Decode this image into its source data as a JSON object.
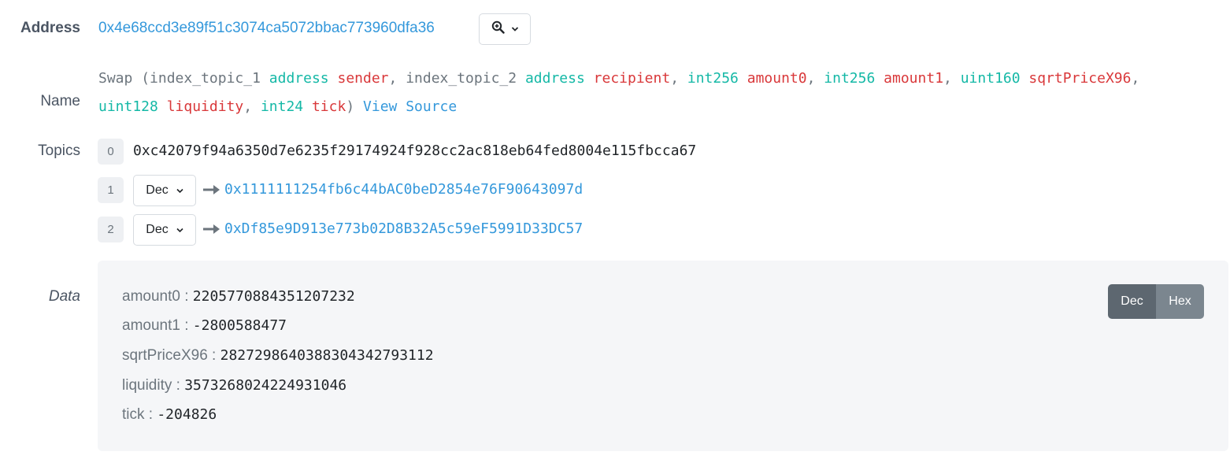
{
  "address": {
    "label": "Address",
    "value": "0x4e68ccd3e89f51c3074ca5072bbac773960dfa36",
    "zoom_icon": "zoom-in-icon",
    "dropdown_icon": "chevron-down-icon"
  },
  "name": {
    "label": "Name",
    "function_name": "Swap",
    "params": [
      {
        "prefix": "index_topic_1",
        "type": "address",
        "name": "sender"
      },
      {
        "prefix": "index_topic_2",
        "type": "address",
        "name": "recipient"
      },
      {
        "prefix": "",
        "type": "int256",
        "name": "amount0"
      },
      {
        "prefix": "",
        "type": "int256",
        "name": "amount1"
      },
      {
        "prefix": "",
        "type": "uint160",
        "name": "sqrtPriceX96"
      },
      {
        "prefix": "",
        "type": "uint128",
        "name": "liquidity"
      },
      {
        "prefix": "",
        "type": "int24",
        "name": "tick"
      }
    ],
    "view_source": "View Source"
  },
  "topics": {
    "label": "Topics",
    "items": [
      {
        "index": "0",
        "value": "0xc42079f94a6350d7e6235f29174924f928cc2ac818eb64fed8004e115fbcca67",
        "format": ""
      },
      {
        "index": "1",
        "value": "0x1111111254fb6c44bAC0beD2854e76F90643097d",
        "format": "Dec"
      },
      {
        "index": "2",
        "value": "0xDf85e9D913e773b02D8B32A5c59eF5991D33DC57",
        "format": "Dec"
      }
    ],
    "arrow_icon": "arrow-right-icon"
  },
  "data": {
    "label": "Data",
    "rows": [
      {
        "key": "amount0",
        "value": "2205770884351207232"
      },
      {
        "key": "amount1",
        "value": "-2800588477"
      },
      {
        "key": "sqrtPriceX96",
        "value": "2827298640388304342793112"
      },
      {
        "key": "liquidity",
        "value": "3573268024224931046"
      },
      {
        "key": "tick",
        "value": "-204826"
      }
    ],
    "toggle": {
      "dec": "Dec",
      "hex": "Hex",
      "selected": "Dec"
    }
  },
  "colors": {
    "link": "#3498db",
    "type": "#14b8a6",
    "param_name": "#d9383a",
    "muted": "#6c757d",
    "panel_bg": "#f5f6f8"
  }
}
